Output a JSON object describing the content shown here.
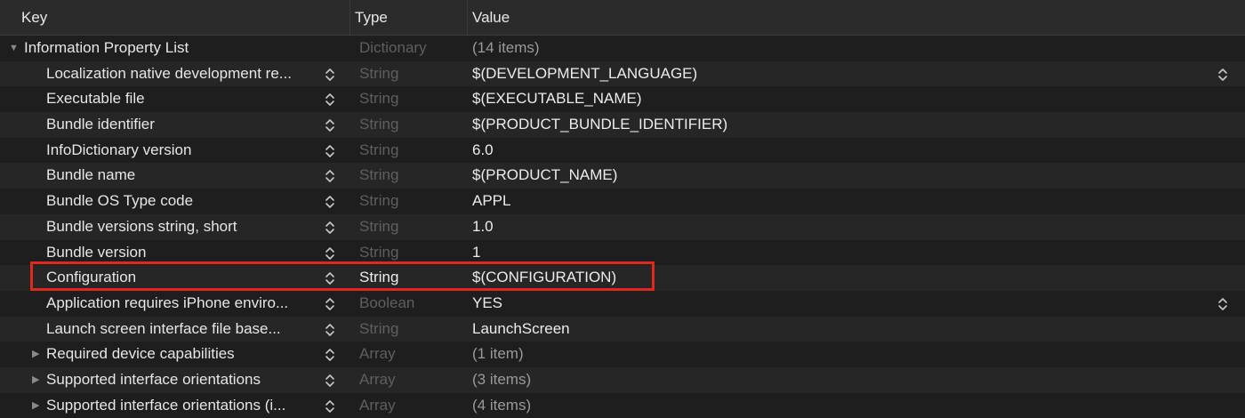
{
  "header": {
    "key": "Key",
    "type": "Type",
    "value": "Value"
  },
  "rows": [
    {
      "key": "Information Property List",
      "type": "Dictionary",
      "value": "(14 items)",
      "kind": "root"
    },
    {
      "key": "Localization native development re...",
      "type": "String",
      "value": "$(DEVELOPMENT_LANGUAGE)",
      "kind": "leaf",
      "value_popup": true
    },
    {
      "key": "Executable file",
      "type": "String",
      "value": "$(EXECUTABLE_NAME)",
      "kind": "leaf"
    },
    {
      "key": "Bundle identifier",
      "type": "String",
      "value": "$(PRODUCT_BUNDLE_IDENTIFIER)",
      "kind": "leaf"
    },
    {
      "key": "InfoDictionary version",
      "type": "String",
      "value": "6.0",
      "kind": "leaf"
    },
    {
      "key": "Bundle name",
      "type": "String",
      "value": "$(PRODUCT_NAME)",
      "kind": "leaf"
    },
    {
      "key": "Bundle OS Type code",
      "type": "String",
      "value": "APPL",
      "kind": "leaf"
    },
    {
      "key": "Bundle versions string, short",
      "type": "String",
      "value": "1.0",
      "kind": "leaf"
    },
    {
      "key": "Bundle version",
      "type": "String",
      "value": "1",
      "kind": "leaf"
    },
    {
      "key": "Configuration",
      "type": "String",
      "value": "$(CONFIGURATION)",
      "kind": "leaf",
      "highlighted": true
    },
    {
      "key": "Application requires iPhone enviro...",
      "type": "Boolean",
      "value": "YES",
      "kind": "leaf",
      "value_popup": true
    },
    {
      "key": "Launch screen interface file base...",
      "type": "String",
      "value": "LaunchScreen",
      "kind": "leaf"
    },
    {
      "key": "Required device capabilities",
      "type": "Array",
      "value": "(1 item)",
      "kind": "collapsed"
    },
    {
      "key": "Supported interface orientations",
      "type": "Array",
      "value": "(3 items)",
      "kind": "collapsed"
    },
    {
      "key": "Supported interface orientations (i...",
      "type": "Array",
      "value": "(4 items)",
      "kind": "collapsed"
    }
  ],
  "colors": {
    "highlight": "#e0281d",
    "background": "#1e1e1e",
    "dim_text": "#5f5f5f"
  },
  "icons": {
    "expanded": "disclosure-triangle-down-icon",
    "collapsed": "disclosure-triangle-right-icon",
    "stepper": "up-down-chevron-icon"
  }
}
